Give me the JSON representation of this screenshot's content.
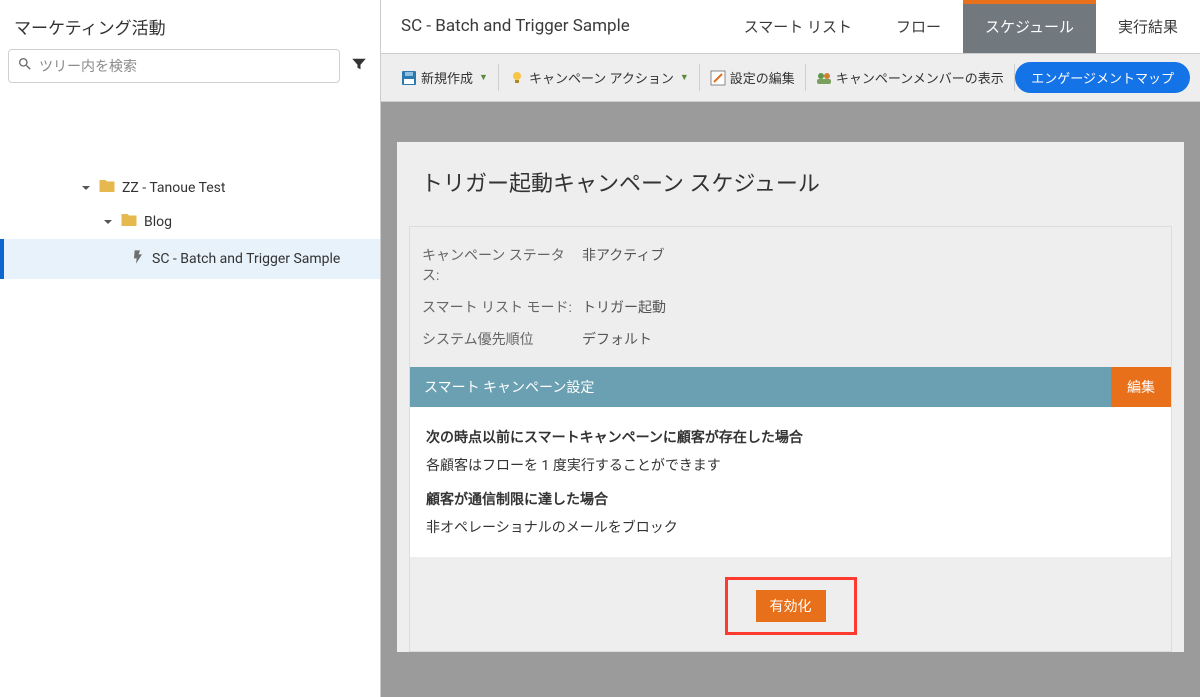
{
  "sidebar": {
    "title": "マーケティング活動",
    "search_placeholder": "ツリー内を検索",
    "tree": {
      "node1": {
        "label": "ZZ - Tanoue Test"
      },
      "node2": {
        "label": "Blog"
      },
      "node3": {
        "label": "SC - Batch and Trigger Sample"
      }
    }
  },
  "tabs": {
    "page_name": "SC - Batch and Trigger Sample",
    "items": {
      "smart_list": "スマート リスト",
      "flow": "フロー",
      "schedule": "スケジュール",
      "results": "実行結果"
    },
    "active": "schedule"
  },
  "toolbar": {
    "new": "新規作成",
    "actions": "キャンペーン アクション",
    "edit_config": "設定の編集",
    "view_members": "キャンペーンメンバーの表示",
    "engagement_map": "エンゲージメントマップ"
  },
  "panel": {
    "title": "トリガー起動キャンペーン スケジュール",
    "status_label": "キャンペーン ステータス:",
    "status_value": "非アクティブ",
    "mode_label": "スマート リスト モード:",
    "mode_value": "トリガー起動",
    "priority_label": "システム優先順位",
    "priority_value": "デフォルト",
    "settings_header": "スマート キャンペーン設定",
    "edit_button": "編集",
    "q1_bold": "次の時点以前にスマートキャンペーンに顧客が存在した場合",
    "q1_text": "各顧客はフローを 1 度実行することができます",
    "q2_bold": "顧客が通信制限に達した場合",
    "q2_text": "非オペレーショナルのメールをブロック",
    "activate": "有効化"
  }
}
